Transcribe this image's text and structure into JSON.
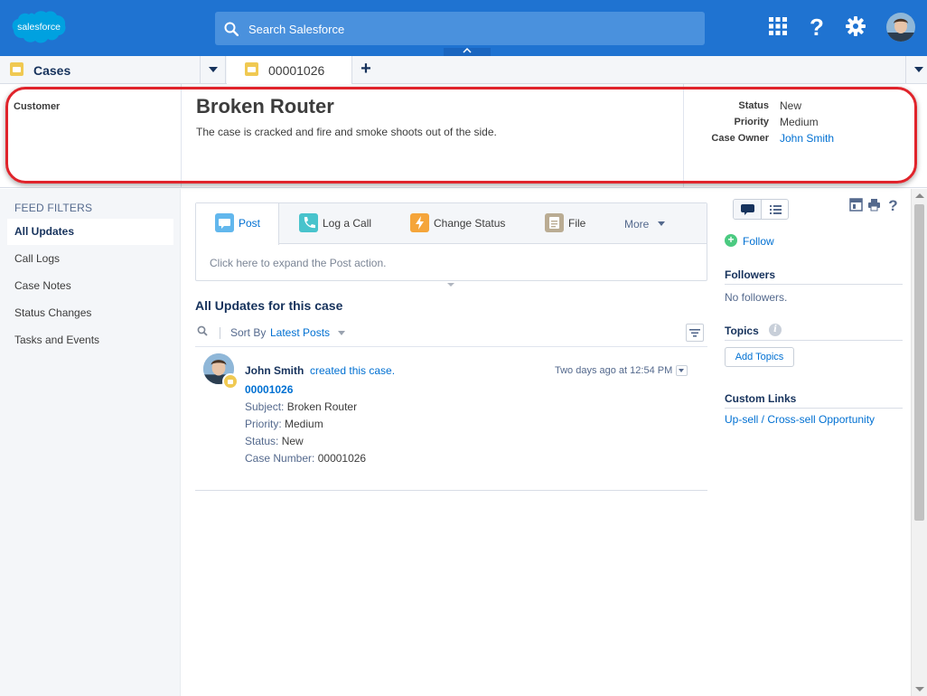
{
  "header": {
    "logo_text": "salesforce",
    "search_placeholder": "Search Salesforce",
    "icons": [
      "app-launcher-icon",
      "help-icon",
      "settings-icon",
      "avatar"
    ]
  },
  "tabs": {
    "object_tab": "Cases",
    "record_tab": "00001026",
    "add_tab_icon": "plus-icon"
  },
  "highlights": {
    "left_label": "Customer",
    "title": "Broken Router",
    "description": "The case is cracked and fire and smoke shoots out of the side.",
    "fields": [
      {
        "label": "Status",
        "value": "New"
      },
      {
        "label": "Priority",
        "value": "Medium"
      },
      {
        "label": "Case Owner",
        "value": "John Smith"
      }
    ]
  },
  "sidebar": {
    "title": "FEED FILTERS",
    "items": [
      {
        "label": "All Updates"
      },
      {
        "label": "Call Logs"
      },
      {
        "label": "Case Notes"
      },
      {
        "label": "Status Changes"
      },
      {
        "label": "Tasks and Events"
      }
    ]
  },
  "publisher": {
    "tabs": [
      {
        "label": "Post",
        "icon": "post-icon"
      },
      {
        "label": "Log a Call",
        "icon": "phone-icon"
      },
      {
        "label": "Change Status",
        "icon": "lightning-icon"
      },
      {
        "label": "File",
        "icon": "file-icon"
      },
      {
        "label": "More",
        "icon": "chevron-down-icon"
      }
    ],
    "placeholder": "Click here to expand the Post action."
  },
  "feed": {
    "title": "All Updates for this case",
    "sort_label": "Sort By",
    "sort_value": "Latest Posts",
    "post": {
      "author": "John Smith",
      "action": "created this case.",
      "time": "Two days ago at 12:54 PM",
      "record": "00001026",
      "lines": [
        {
          "label": "Subject:",
          "value": "Broken Router"
        },
        {
          "label": "Priority:",
          "value": "Medium"
        },
        {
          "label": "Status:",
          "value": "New"
        },
        {
          "label": "Case Number:",
          "value": "00001026"
        }
      ]
    }
  },
  "right": {
    "follow": "Follow",
    "followers_title": "Followers",
    "followers_text": "No followers.",
    "topics_title": "Topics",
    "add_topics": "Add Topics",
    "links_title": "Custom Links",
    "link": "Up-sell / Cross-sell Opportunity"
  },
  "colors": {
    "brand": "#1f73d1",
    "link": "#0070d2",
    "highlight_outline": "#e0242b"
  }
}
